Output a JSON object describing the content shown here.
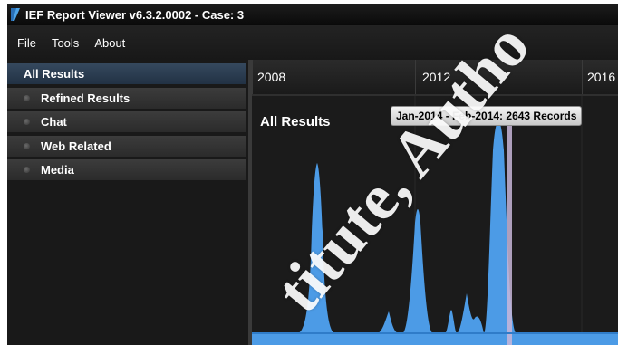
{
  "window": {
    "title": "IEF Report Viewer v6.3.2.0002 - Case: 3"
  },
  "menu": {
    "items": [
      "File",
      "Tools",
      "About"
    ]
  },
  "sidebar": {
    "items": [
      {
        "label": "All Results",
        "active": true
      },
      {
        "label": "Refined Results",
        "active": false
      },
      {
        "label": "Chat",
        "active": false
      },
      {
        "label": "Web Related",
        "active": false
      },
      {
        "label": "Media",
        "active": false
      }
    ]
  },
  "timeline": {
    "years": [
      "2008",
      "2012",
      "2016"
    ]
  },
  "chart": {
    "title": "All Results",
    "tooltip": "Jan-2014 - Feb-2014: 2643 Records"
  },
  "watermark": {
    "text": "titute, Autho"
  },
  "colors": {
    "series_fill": "#4c9be6",
    "highlight": "#c8b6d8",
    "baseline": "#2f7cc9"
  }
}
